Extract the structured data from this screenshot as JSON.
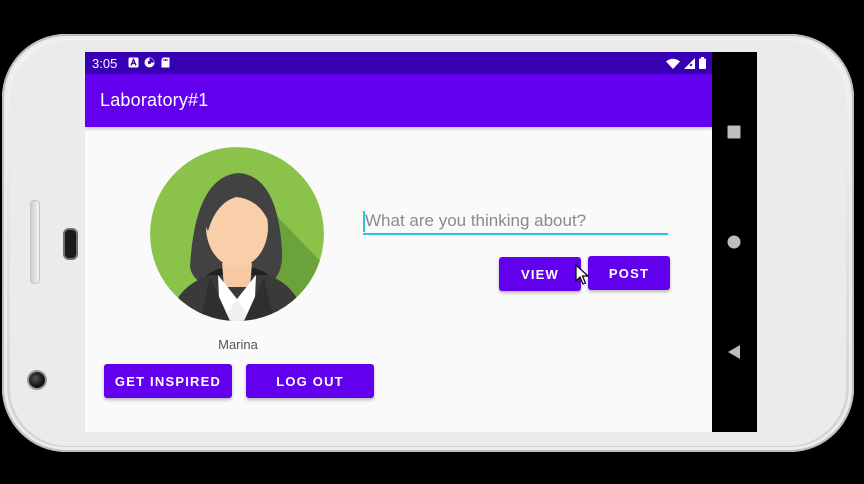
{
  "status_bar": {
    "time": "3:05",
    "left_icons": [
      "a-notification-icon",
      "pie-notification-icon",
      "sd-card-icon"
    ],
    "right_icons": [
      "wifi-icon",
      "signal-icon",
      "battery-icon"
    ]
  },
  "app_bar": {
    "title": "Laboratory#1"
  },
  "profile": {
    "name": "Marina",
    "avatar_icon": "woman-avatar-icon"
  },
  "buttons": {
    "get_inspired": "GET INSPIRED",
    "log_out": "LOG OUT",
    "view": "VIEW",
    "post": "POST"
  },
  "post_input": {
    "placeholder": "What are you thinking about?",
    "value": ""
  },
  "nav_bar": {
    "items": [
      "recents-square-icon",
      "home-circle-icon",
      "back-triangle-icon"
    ]
  },
  "colors": {
    "status_bar": "#3700b3",
    "primary": "#6200ee",
    "input_accent": "#26c6da",
    "avatar_bg": "#8bc34a"
  }
}
